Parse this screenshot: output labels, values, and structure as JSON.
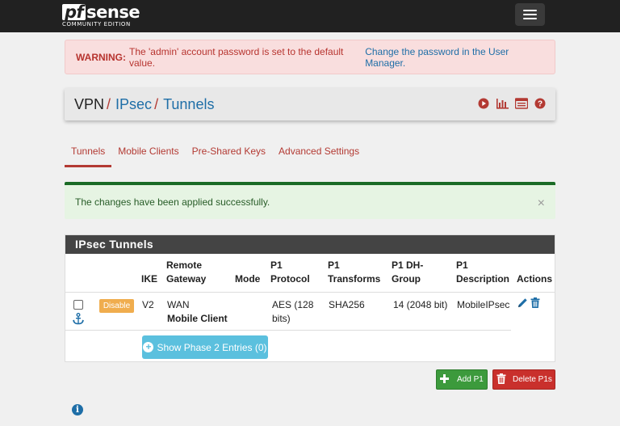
{
  "app": {
    "logo_text": "sense",
    "logo_pf": "pf",
    "logo_sub": "COMMUNITY EDITION"
  },
  "warning": {
    "label": "WARNING:",
    "text": "The 'admin' account password is set to the default value.",
    "link": "Change the password in the User Manager."
  },
  "breadcrumb": [
    {
      "label": "VPN"
    },
    {
      "label": "IPsec"
    },
    {
      "label": "Tunnels"
    }
  ],
  "breadcrumb_sep": "/",
  "header_icons": [
    "play-circle-icon",
    "bar-chart-icon",
    "log-list-icon",
    "help-icon"
  ],
  "tabs": [
    {
      "label": "Tunnels",
      "active": true
    },
    {
      "label": "Mobile Clients",
      "active": false
    },
    {
      "label": "Pre-Shared Keys",
      "active": false
    },
    {
      "label": "Advanced Settings",
      "active": false
    }
  ],
  "success": {
    "text": "The changes have been applied successfully.",
    "close": "×"
  },
  "panel": {
    "title": "IPsec Tunnels",
    "columns": {
      "ike": "IKE",
      "remote_gateway_1": "Remote",
      "remote_gateway_2": "Gateway",
      "mode": "Mode",
      "p1_protocol_1": "P1",
      "p1_protocol_2": "Protocol",
      "p1_transforms_1": "P1",
      "p1_transforms_2": "Transforms",
      "p1_dh_1": "P1 DH-",
      "p1_dh_2": "Group",
      "p1_desc_1": "P1",
      "p1_desc_2": "Description",
      "actions": "Actions"
    },
    "rows": [
      {
        "status_button": "Disable",
        "ike": "V2",
        "gateway": "WAN",
        "gateway_sub": "Mobile Client",
        "protocol_1": "AES (128",
        "protocol_2": "bits)",
        "transforms": "SHA256",
        "dh_group": "14 (2048 bit)",
        "description": "MobileIPsec"
      }
    ],
    "phase2_button": "Show Phase 2 Entries (0)"
  },
  "buttons": {
    "add_p1": "Add P1",
    "delete_p1": "Delete P1s"
  },
  "colors": {
    "brand_red": "#b33a33",
    "link_blue": "#1e6ea7",
    "topbar": "#212121",
    "success_green": "#1a6b26",
    "warning_bg": "#f9dede"
  }
}
